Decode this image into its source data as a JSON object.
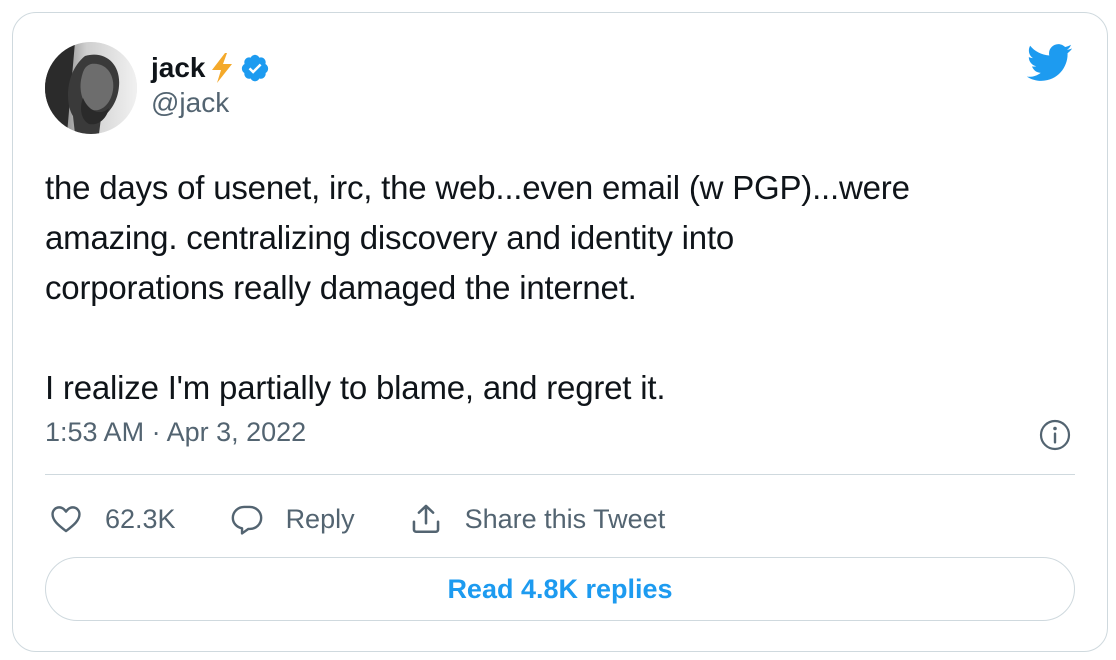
{
  "author": {
    "name": "jack",
    "name_emoji_icon": "high-voltage-icon",
    "verified_icon": "verified-badge-icon",
    "handle": "@jack"
  },
  "brand_icon": "twitter-bird-icon",
  "tweet": {
    "text": "the days of usenet, irc, the web...even email (w PGP)...were\namazing. centralizing discovery and identity into\ncorporations really damaged the internet.\n\nI realize I'm partially to blame, and regret it.",
    "timestamp": "1:53 AM · Apr 3, 2022"
  },
  "actions": {
    "likes": "62.3K",
    "reply_label": "Reply",
    "share_label": "Share this Tweet"
  },
  "read_replies_label": "Read 4.8K replies",
  "colors": {
    "accent": "#1d9bf0",
    "text_primary": "#0f1419",
    "text_secondary": "#536471",
    "border": "#cfd9de",
    "bolt": "#f4a92a"
  }
}
